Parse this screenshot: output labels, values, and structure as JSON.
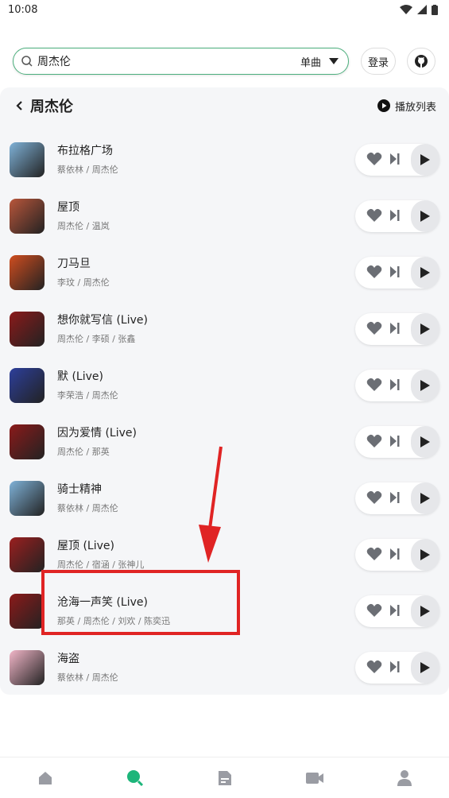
{
  "status": {
    "time": "10:08"
  },
  "search": {
    "query": "周杰伦",
    "type": "单曲"
  },
  "header": {
    "login_label": "登录"
  },
  "panel": {
    "title": "周杰伦",
    "playlist_label": "播放列表"
  },
  "songs": [
    {
      "title": "布拉格广场",
      "artist": "蔡依林 / 周杰伦",
      "cover": "#7fb2d8"
    },
    {
      "title": "屋顶",
      "artist": "周杰伦 / 温岚",
      "cover": "#b9563b"
    },
    {
      "title": "刀马旦",
      "artist": "李玟 / 周杰伦",
      "cover": "#d04d1f"
    },
    {
      "title": "想你就写信 (Live)",
      "artist": "周杰伦 / 李硕 / 张鑫",
      "cover": "#8b1a1a"
    },
    {
      "title": "默 (Live)",
      "artist": "李荣浩 / 周杰伦",
      "cover": "#2d3f9b"
    },
    {
      "title": "因为爱情 (Live)",
      "artist": "周杰伦 / 那英",
      "cover": "#8b1a1a"
    },
    {
      "title": "骑士精神",
      "artist": "蔡依林 / 周杰伦",
      "cover": "#7fb2d8"
    },
    {
      "title": "屋顶 (Live)",
      "artist": "周杰伦 / 宿涵 / 张神儿",
      "cover": "#9b1f1f"
    },
    {
      "title": "沧海一声笑 (Live)",
      "artist": "那英 / 周杰伦 / 刘欢 / 陈奕迅",
      "cover": "#8b1a1a"
    },
    {
      "title": "海盗",
      "artist": "蔡依林 / 周杰伦",
      "cover": "#f2b6c8"
    }
  ],
  "colors": {
    "accent": "#1db57a",
    "highlight": "#e02424",
    "panel_bg": "#f5f6f8"
  },
  "nav": [
    {
      "icon": "home-icon"
    },
    {
      "icon": "search-icon",
      "active": true
    },
    {
      "icon": "document-icon"
    },
    {
      "icon": "video-icon"
    },
    {
      "icon": "user-icon"
    }
  ]
}
